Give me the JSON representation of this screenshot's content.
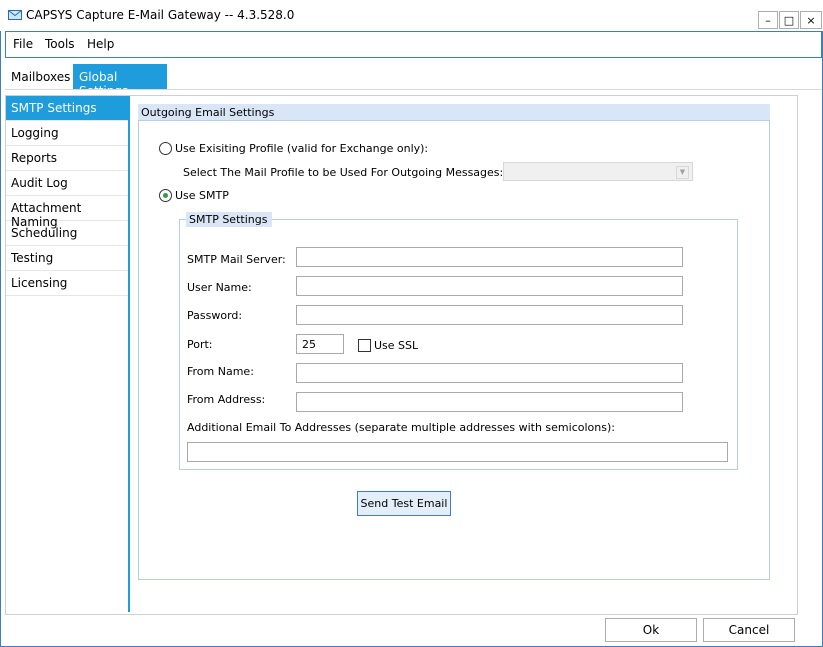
{
  "window": {
    "title": "CAPSYS Capture E-Mail Gateway -- 4.3.528.0",
    "minimize": "–",
    "maximize": "□",
    "close": "×"
  },
  "menu": [
    "File",
    "Tools",
    "Help"
  ],
  "tabs": [
    {
      "label": "Mailboxes",
      "active": false
    },
    {
      "label": "Global Settings",
      "active": true
    }
  ],
  "sidebar": {
    "items": [
      {
        "label": "SMTP Settings",
        "active": true
      },
      {
        "label": "Logging"
      },
      {
        "label": "Reports"
      },
      {
        "label": "Audit Log"
      },
      {
        "label": "Attachment Naming"
      },
      {
        "label": "Scheduling"
      },
      {
        "label": "Testing"
      },
      {
        "label": "Licensing"
      }
    ]
  },
  "outgoing": {
    "header": "Outgoing Email Settings",
    "radio_profile": "Use Exisiting Profile (valid for Exchange only):",
    "profile_select_label": "Select The Mail Profile to be Used For Outgoing Messages:",
    "profile_selected": "",
    "radio_smtp": "Use SMTP",
    "selected_mode": "smtp"
  },
  "smtp": {
    "header": "SMTP Settings",
    "server_label": "SMTP Mail Server:",
    "server_value": "",
    "username_label": "User Name:",
    "username_value": "",
    "password_label": "Password:",
    "password_value": "",
    "port_label": "Port:",
    "port_value": "25",
    "ssl_label": "Use SSL",
    "ssl_checked": false,
    "from_name_label": "From Name:",
    "from_name_value": "",
    "from_address_label": "From Address:",
    "from_address_value": "",
    "additional_label": "Additional Email To Addresses (separate multiple addresses with semicolons):",
    "additional_value": ""
  },
  "buttons": {
    "send_test": "Send Test Email",
    "ok": "Ok",
    "cancel": "Cancel"
  },
  "colors": {
    "accent": "#1e9cdc",
    "group_header": "#d9e6f5",
    "radio_checked": "#2f9e44"
  }
}
